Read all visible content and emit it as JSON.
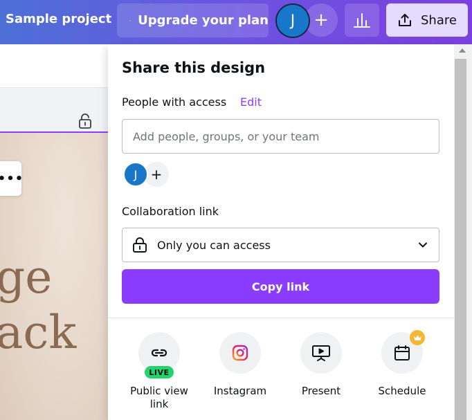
{
  "topbar": {
    "project_title": "Sample project",
    "upgrade_label": "Upgrade your plan",
    "avatar_initial": "J",
    "add_symbol": "+",
    "share_label": "Share"
  },
  "canvas": {
    "line1": "ge",
    "line2": "ack",
    "more_symbol": "•••"
  },
  "share_panel": {
    "title": "Share this design",
    "people_label": "People with access",
    "edit_label": "Edit",
    "people_input_placeholder": "Add people, groups, or your team",
    "avatar_initial": "J",
    "add_symbol": "+",
    "collab_label": "Collaboration link",
    "access_value": "Only you can access",
    "copy_link_label": "Copy link",
    "options": [
      {
        "label": "Public view link",
        "badge": "LIVE",
        "icon": "link-icon"
      },
      {
        "label": "Instagram",
        "icon": "instagram-icon"
      },
      {
        "label": "Present",
        "icon": "present-icon"
      },
      {
        "label": "Schedule",
        "icon": "calendar-icon",
        "premium": true
      }
    ]
  },
  "colors": {
    "accent": "#8b3dff",
    "avatar": "#1877c9",
    "live": "#24d36b",
    "crown": "#f5b631"
  }
}
